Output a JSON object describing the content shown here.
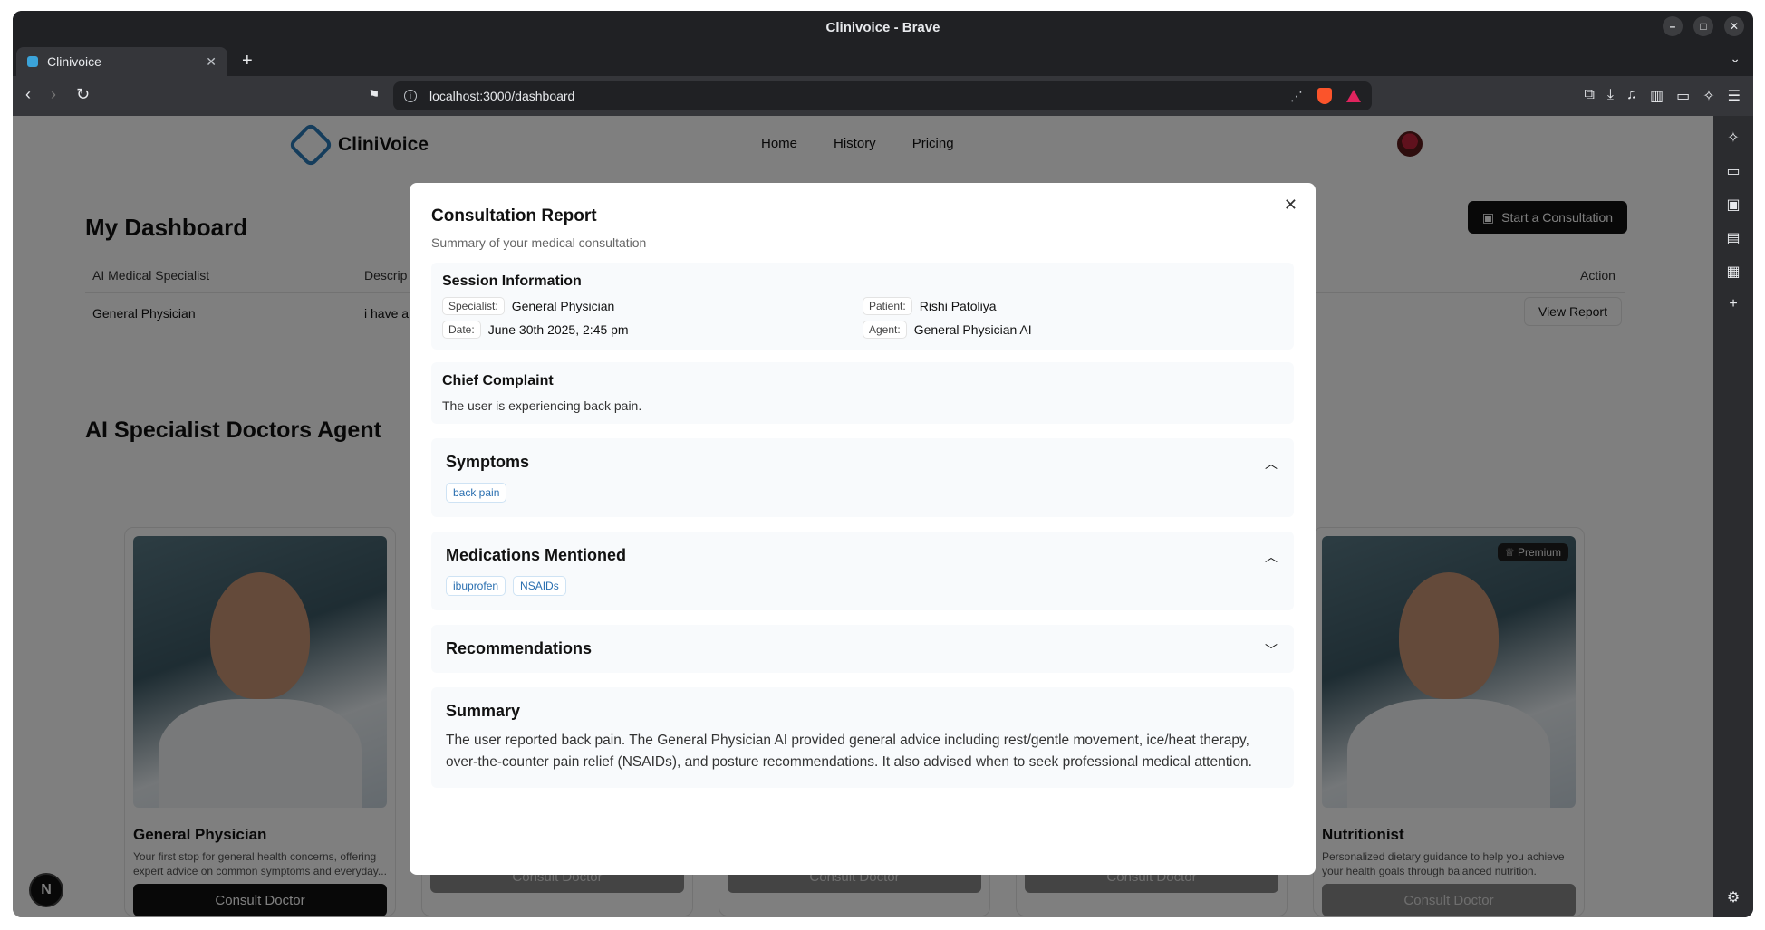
{
  "window": {
    "title": "Clinivoice - Brave"
  },
  "tab": {
    "title": "Clinivoice"
  },
  "url": "localhost:3000/dashboard",
  "site": {
    "brand": "CliniVoice",
    "nav": {
      "home": "Home",
      "history": "History",
      "pricing": "Pricing"
    }
  },
  "dashboard": {
    "title": "My Dashboard",
    "start_button": "Start a Consultation",
    "table": {
      "headers": {
        "specialist": "AI Medical Specialist",
        "description": "Descrip",
        "action": "Action"
      },
      "row": {
        "specialist": "General Physician",
        "description": "i have a",
        "action": "View Report"
      }
    }
  },
  "agents": {
    "title": "AI Specialist Doctors Agent",
    "premium_label": "Premium",
    "consult_label": "Consult Doctor",
    "cards": [
      {
        "name": "General Physician",
        "desc": "Your first stop for general health concerns, offering expert advice on common symptoms and everyday..."
      },
      {
        "name": "",
        "desc": ""
      },
      {
        "name": "",
        "desc": ""
      },
      {
        "name": "",
        "desc": ""
      },
      {
        "name": "Nutritionist",
        "desc": "Personalized dietary guidance to help you achieve your health goals through balanced nutrition."
      }
    ]
  },
  "modal": {
    "title": "Consultation Report",
    "subtitle": "Summary of your medical consultation",
    "session": {
      "heading": "Session Information",
      "specialist_label": "Specialist:",
      "specialist": "General Physician",
      "patient_label": "Patient:",
      "patient": "Rishi Patoliya",
      "date_label": "Date:",
      "date": "June 30th 2025, 2:45 pm",
      "agent_label": "Agent:",
      "agent": "General Physician AI"
    },
    "chief": {
      "heading": "Chief Complaint",
      "text": "The user is experiencing back pain."
    },
    "symptoms": {
      "heading": "Symptoms",
      "items": [
        "back pain"
      ]
    },
    "medications": {
      "heading": "Medications Mentioned",
      "items": [
        "ibuprofen",
        "NSAIDs"
      ]
    },
    "recommendations": {
      "heading": "Recommendations"
    },
    "summary": {
      "heading": "Summary",
      "text": "The user reported back pain. The General Physician AI provided general advice including rest/gentle movement, ice/heat therapy, over-the-counter pain relief (NSAIDs), and posture recommendations. It also advised when to seek professional medical attention."
    }
  },
  "icons": {
    "close": "close-icon",
    "chevron_up": "chevron-up-icon",
    "chevron_down": "chevron-down-icon"
  },
  "colors": {
    "accent": "#2b7ab8",
    "pill_text": "#2a6fb0",
    "overlay": "rgba(0,0,0,0.5)"
  }
}
